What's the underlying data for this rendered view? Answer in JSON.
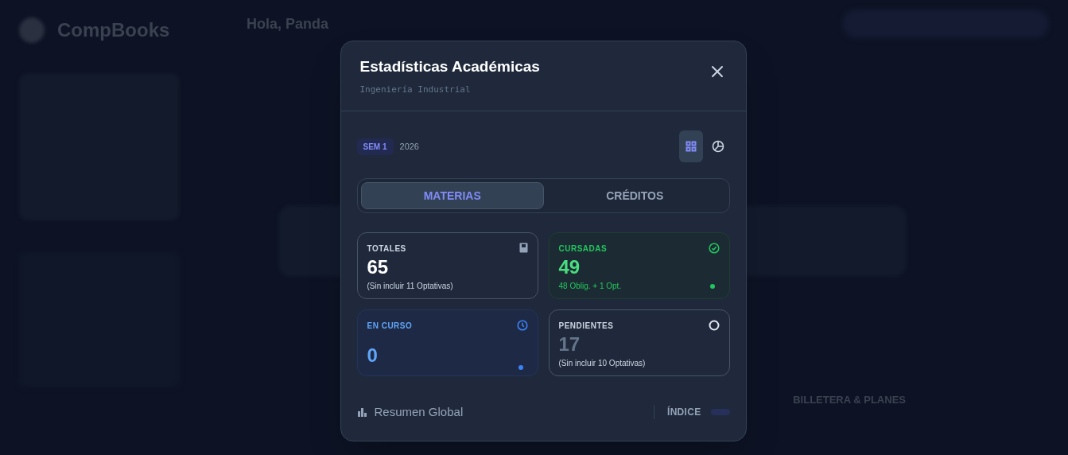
{
  "background": {
    "brand": "CompBooks",
    "greeting": "Hola, Panda",
    "section_label": "BILLETERA & PLANES"
  },
  "modal": {
    "title": "Estadísticas Académicas",
    "subtitle": "Ingeniería Industrial",
    "semester_badge": "SEM 1",
    "year": "2026",
    "view_toggles": [
      {
        "kind": "grid",
        "selected": true
      },
      {
        "kind": "chart",
        "selected": false
      }
    ],
    "tabs": [
      {
        "label": "MATERIAS",
        "selected": true
      },
      {
        "label": "CRÉDITOS",
        "selected": false
      }
    ],
    "stats": [
      {
        "kind": "total",
        "label": "TOTALES",
        "value": "65",
        "note": "(Sin incluir 11 Optativas)"
      },
      {
        "kind": "done",
        "label": "CURSADAS",
        "value": "49",
        "note": "48 Oblig. + 1 Opt."
      },
      {
        "kind": "current",
        "label": "EN CURSO",
        "value": "0"
      },
      {
        "kind": "pending",
        "label": "PENDIENTES",
        "value": "17",
        "note": "(Sin incluir 10 Optativas)"
      }
    ],
    "footer": {
      "summary": "Resumen Global",
      "index_label": "ÍNDICE"
    }
  }
}
